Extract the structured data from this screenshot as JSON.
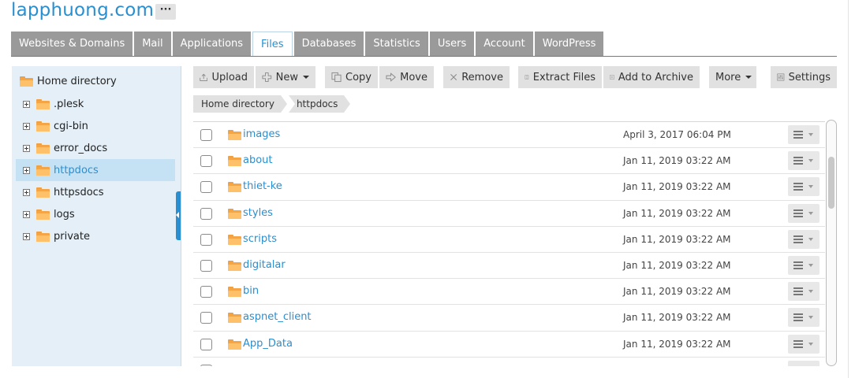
{
  "site": {
    "title": "lapphuong.com",
    "more_label": "···"
  },
  "tabs": [
    {
      "label": "Websites & Domains",
      "active": false
    },
    {
      "label": "Mail",
      "active": false
    },
    {
      "label": "Applications",
      "active": false
    },
    {
      "label": "Files",
      "active": true
    },
    {
      "label": "Databases",
      "active": false
    },
    {
      "label": "Statistics",
      "active": false
    },
    {
      "label": "Users",
      "active": false
    },
    {
      "label": "Account",
      "active": false
    },
    {
      "label": "WordPress",
      "active": false
    }
  ],
  "tree": {
    "root_label": "Home directory",
    "items": [
      {
        "label": ".plesk",
        "selected": false
      },
      {
        "label": "cgi-bin",
        "selected": false
      },
      {
        "label": "error_docs",
        "selected": false
      },
      {
        "label": "httpdocs",
        "selected": true
      },
      {
        "label": "httpsdocs",
        "selected": false
      },
      {
        "label": "logs",
        "selected": false
      },
      {
        "label": "private",
        "selected": false
      }
    ]
  },
  "toolbar": {
    "upload": "Upload",
    "new": "New",
    "copy": "Copy",
    "move": "Move",
    "remove": "Remove",
    "extract": "Extract Files",
    "archive": "Add to Archive",
    "more": "More",
    "settings": "Settings"
  },
  "breadcrumb": [
    "Home directory",
    "httpdocs"
  ],
  "files": [
    {
      "name": "images",
      "modified": "April 3, 2017 06:04 PM"
    },
    {
      "name": "about",
      "modified": "Jan 11, 2019 03:22 AM"
    },
    {
      "name": "thiet-ke",
      "modified": "Jan 11, 2019 03:22 AM"
    },
    {
      "name": "styles",
      "modified": "Jan 11, 2019 03:22 AM"
    },
    {
      "name": "scripts",
      "modified": "Jan 11, 2019 03:22 AM"
    },
    {
      "name": "digitalar",
      "modified": "Jan 11, 2019 03:22 AM"
    },
    {
      "name": "bin",
      "modified": "Jan 11, 2019 03:22 AM"
    },
    {
      "name": "aspnet_client",
      "modified": "Jan 11, 2019 03:22 AM"
    },
    {
      "name": "App_Data",
      "modified": "Jan 11, 2019 03:22 AM"
    }
  ],
  "colors": {
    "accent": "#2a8fd0",
    "tab_inactive": "#9a9a9a",
    "tree_bg": "#e4eff7",
    "tree_selected": "#c5e2f5",
    "folder": "#f6a545"
  },
  "icons": {
    "upload": "upload-icon",
    "new": "plus-icon",
    "copy": "copy-icon",
    "move": "arrow-right-icon",
    "remove": "x-icon",
    "extract": "extract-icon",
    "archive": "archive-icon",
    "settings": "settings-icon",
    "folder": "folder-icon",
    "row_menu": "hamburger-icon"
  }
}
